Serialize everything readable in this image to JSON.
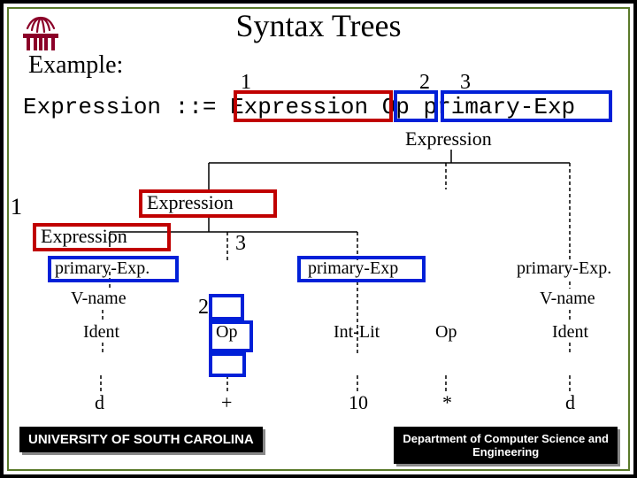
{
  "title": "Syntax Trees",
  "example_label": "Example:",
  "grammar": {
    "lhs": "Expression",
    "derives": "::=",
    "rhs1": "Expression",
    "rhs2": "Op",
    "rhs3": "primary-Exp",
    "n1": "1",
    "n2": "2",
    "n3": "3"
  },
  "tree": {
    "root": "Expression",
    "side1": "1",
    "l2_expr": "Expression",
    "l3_expr": "Expression",
    "l3_num": "3",
    "primL": "primary-Exp.",
    "primM": "primary-Exp",
    "primR": "primary-Exp.",
    "vnameL": "V-name",
    "vnameR": "V-name",
    "num2": "2",
    "identL": "Ident",
    "identR": "Ident",
    "opL": "Op",
    "opR": "Op",
    "intlit": "Int-Lit",
    "leaf_d1": "d",
    "leaf_plus": "+",
    "leaf_10": "10",
    "leaf_star": "*",
    "leaf_d2": "d"
  },
  "footer": {
    "left": "UNIVERSITY OF SOUTH CAROLINA",
    "right_l1": "Department of Computer Science and",
    "right_l2": "Engineering"
  }
}
